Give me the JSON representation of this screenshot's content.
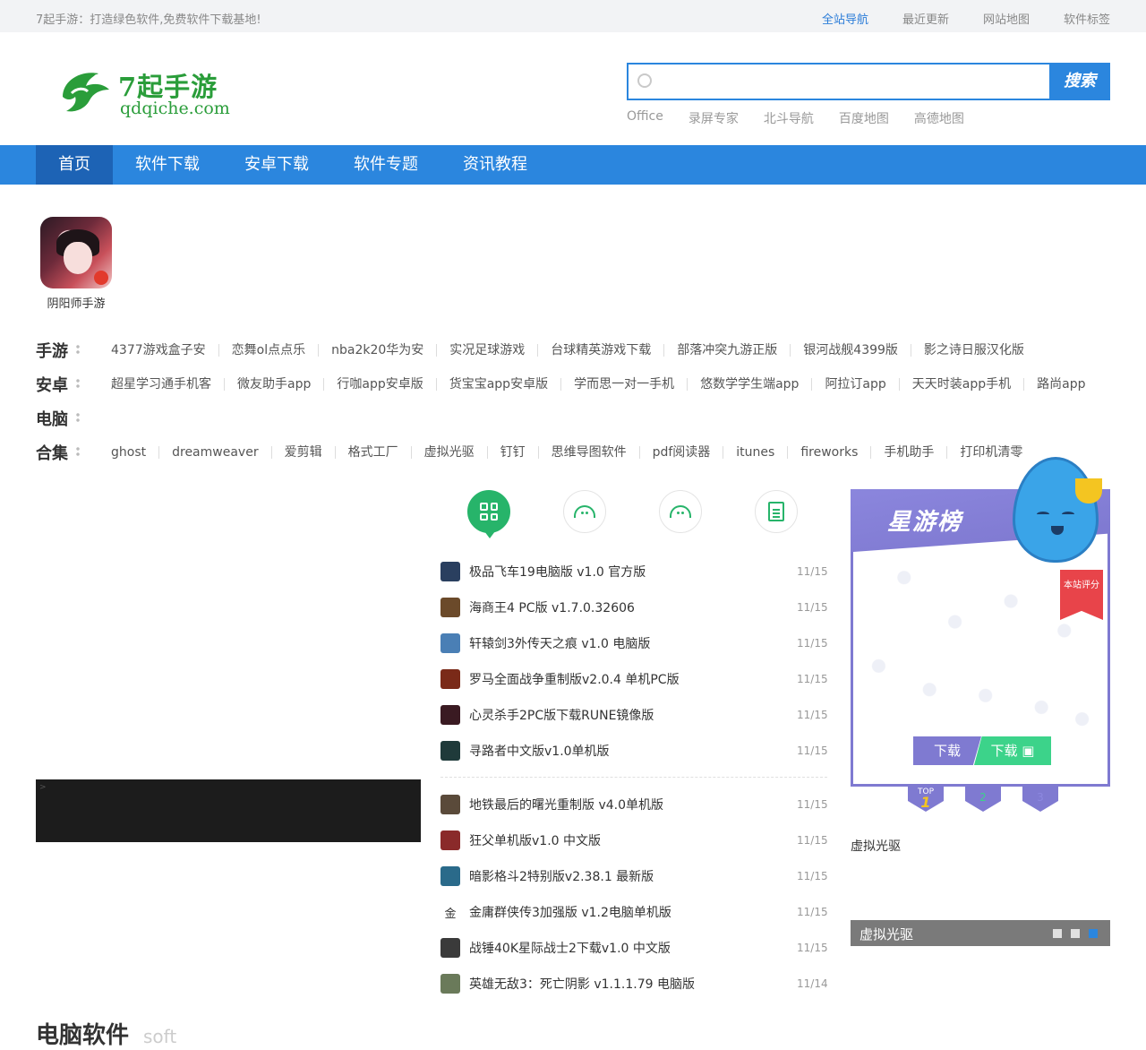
{
  "topbar": {
    "slogan": "7起手游：打造绿色软件,免费软件下载基地!",
    "links": [
      "全站导航",
      "最近更新",
      "网站地图",
      "软件标签"
    ]
  },
  "logo": {
    "brand": "7起手游",
    "domain": "qdqiche.com"
  },
  "search": {
    "placeholder": "",
    "button": "搜索",
    "hotwords": [
      "Office",
      "录屏专家",
      "北斗导航",
      "百度地图",
      "高德地图"
    ]
  },
  "nav": [
    "首页",
    "软件下载",
    "安卓下载",
    "软件专题",
    "资讯教程"
  ],
  "featured": {
    "name": "阴阳师手游"
  },
  "tagrows": [
    {
      "label": "手游",
      "tags": [
        "4377游戏盒子安",
        "恋舞ol点点乐",
        "nba2k20华为安",
        "实况足球游戏",
        "台球精英游戏下载",
        "部落冲突九游正版",
        "银河战舰4399版",
        "影之诗日服汉化版"
      ]
    },
    {
      "label": "安卓",
      "tags": [
        "超星学习通手机客",
        "微友助手app",
        "行咖app安卓版",
        "货宝宝app安卓版",
        "学而思一对一手机",
        "悠数学学生端app",
        "阿拉订app",
        "天天时装app手机",
        "路尚app"
      ]
    },
    {
      "label": "电脑",
      "tags": []
    },
    {
      "label": "合集",
      "tags": [
        "ghost",
        "dreamweaver",
        "爱剪辑",
        "格式工厂",
        "虚拟光驱",
        "钉钉",
        "思维导图软件",
        "pdf阅读器",
        "itunes",
        "fireworks",
        "手机助手",
        "打印机清零"
      ]
    }
  ],
  "softlist": {
    "group1": [
      {
        "title": "极品飞车19电脑版 v1.0 官方版",
        "date": "11/15",
        "icon": "#2a3f5f"
      },
      {
        "title": "海商王4 PC版 v1.7.0.32606",
        "date": "11/15",
        "icon": "#6b4a2a"
      },
      {
        "title": "轩辕剑3外传天之痕 v1.0 电脑版",
        "date": "11/15",
        "icon": "#4a7fb5"
      },
      {
        "title": "罗马全面战争重制版v2.0.4 单机PC版",
        "date": "11/15",
        "icon": "#7a2a18"
      },
      {
        "title": "心灵杀手2PC版下载RUNE镜像版",
        "date": "11/15",
        "icon": "#3a1a22"
      },
      {
        "title": "寻路者中文版v1.0单机版",
        "date": "11/15",
        "icon": "#1f3a3a"
      }
    ],
    "group2": [
      {
        "title": "地铁最后的曙光重制版 v4.0单机版",
        "date": "11/15",
        "icon": "#5a4a3a"
      },
      {
        "title": "狂父单机版v1.0 中文版",
        "date": "11/15",
        "icon": "#8a2a2a"
      },
      {
        "title": "暗影格斗2特别版v2.38.1 最新版",
        "date": "11/15",
        "icon": "#2a6a8a"
      },
      {
        "title": "金庸群侠传3加强版 v1.2电脑单机版",
        "date": "11/15",
        "icon": "",
        "glyph": "金"
      },
      {
        "title": "战锤40K星际战士2下载v1.0 中文版",
        "date": "11/15",
        "icon": "#3a3a3a"
      },
      {
        "title": "英雄无敌3：死亡阴影 v1.1.1.79 电脑版",
        "date": "11/14",
        "icon": "#6a7a5a"
      }
    ]
  },
  "starpanel": {
    "title": "星游榜",
    "ribbon": "本站评分",
    "ios_label": "下载",
    "android_label": "下载",
    "ranks": [
      "TOP",
      "1",
      "2",
      "3"
    ]
  },
  "side": {
    "label": "虚拟光驱",
    "banner_title": "虚拟光驱"
  },
  "section": {
    "cn": "电脑软件",
    "en": "soft"
  },
  "colors": {
    "accent": "#2b86de",
    "nav_current": "#1d63b5",
    "green": "#27b46a",
    "purple": "#7f7ad1"
  }
}
